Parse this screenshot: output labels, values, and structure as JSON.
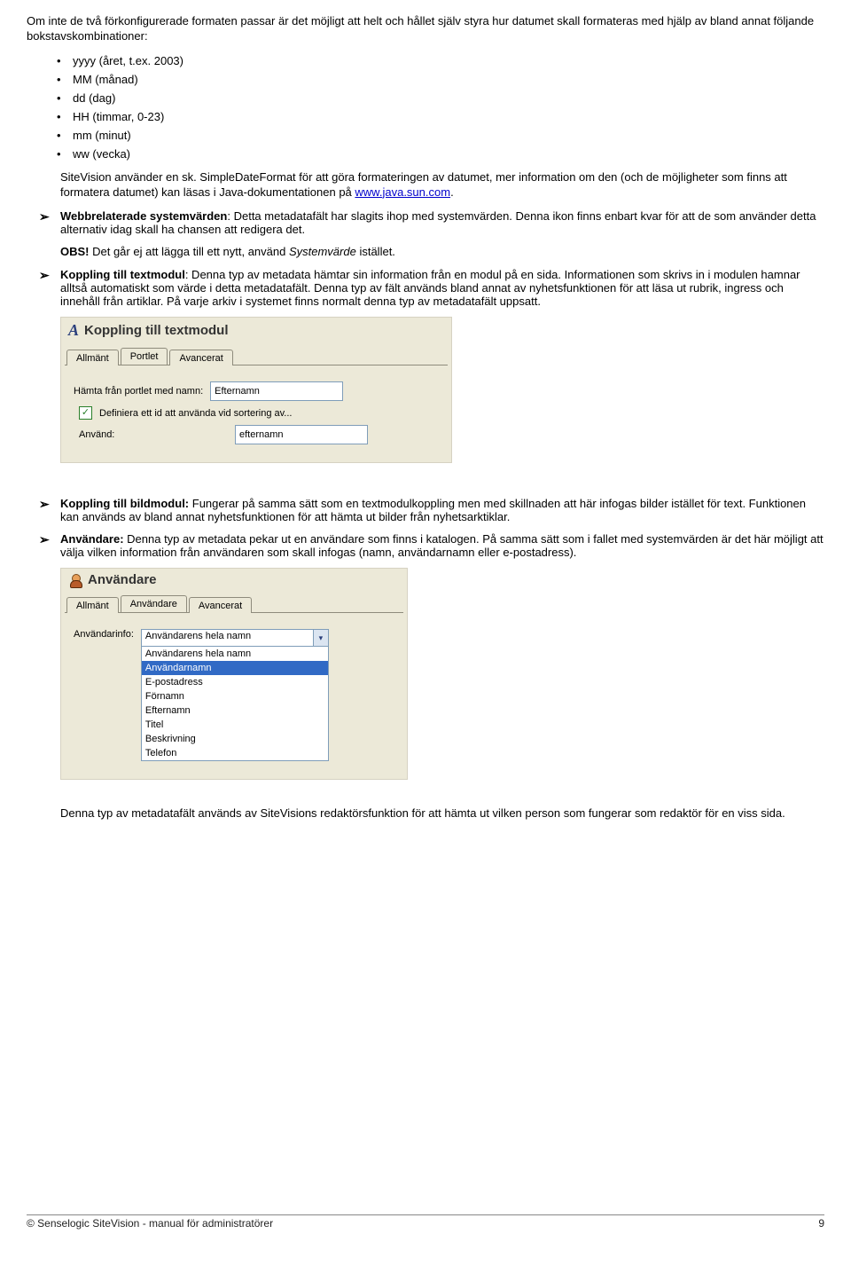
{
  "intro": "Om inte de två förkonfigurerade formaten passar är det möjligt att helt och hållet själv styra hur datumet skall formateras med hjälp av bland annat följande bokstavskombinationer:",
  "format_tokens": [
    "yyyy (året, t.ex. 2003)",
    "MM (månad)",
    "dd (dag)",
    "HH (timmar, 0-23)",
    "mm (minut)",
    "ww (vecka)"
  ],
  "sdf_pre": "SiteVision använder en sk. SimpleDateFormat för att göra formateringen av datumet, mer information om den (och de möjligheter som finns att formatera datumet) kan läsas i Java-dokumentationen på ",
  "sdf_link": "www.java.sun.com",
  "sdf_post": ".",
  "webrel": {
    "label": "Webbrelaterade systemvärden",
    "text": ": Detta metadatafält har slagits ihop med systemvärden. Denna ikon finns enbart kvar för att de som använder detta alternativ idag skall ha chansen att redigera det.",
    "obs_label": "OBS!",
    "obs_text": " Det går ej att lägga till ett nytt, använd ",
    "obs_ital": "Systemvärde",
    "obs_tail": " istället."
  },
  "textmodul": {
    "label": "Koppling till textmodul",
    "text": ": Denna typ av metadata hämtar sin information från en modul på en sida. Informationen som skrivs in i modulen hamnar alltså automatiskt som värde i detta metadatafält. Denna typ av fält används bland annat av nyhetsfunktionen för att läsa ut rubrik, ingress och innehåll från artiklar. På varje arkiv i systemet finns normalt denna typ av metadatafält uppsatt."
  },
  "panel1": {
    "title": "Koppling till textmodul",
    "tabs": [
      "Allmänt",
      "Portlet",
      "Avancerat"
    ],
    "active_tab": 1,
    "row1_label": "Hämta från portlet med namn:",
    "row1_value": "Efternamn",
    "check_label": "Definiera ett id att använda vid sortering av...",
    "row2_label": "Använd:",
    "row2_value": "efternamn"
  },
  "bildmodul": {
    "label": "Koppling till bildmodul:",
    "text": " Fungerar på samma sätt som en textmodulkoppling men med skillnaden att här infogas bilder istället för text. Funktionen kan används av bland annat nyhetsfunktionen för att hämta ut bilder från nyhetsarktiklar."
  },
  "anvandare": {
    "label": "Användare:",
    "text": " Denna typ av metadata pekar ut en användare som finns i katalogen. På samma sätt som i fallet med systemvärden är det här möjligt att välja vilken information från användaren som skall infogas (namn, användarnamn eller e-postadress)."
  },
  "panel2": {
    "title": "Användare",
    "tabs": [
      "Allmänt",
      "Användare",
      "Avancerat"
    ],
    "active_tab": 1,
    "label": "Användarinfo:",
    "selected": "Användarens hela namn",
    "options": [
      "Användarens hela namn",
      "Användarnamn",
      "E-postadress",
      "Förnamn",
      "Efternamn",
      "Titel",
      "Beskrivning",
      "Telefon"
    ],
    "highlight_index": 1
  },
  "closing": "Denna typ av metadatafält används av SiteVisions redaktörsfunktion för att hämta ut vilken person som fungerar som redaktör för en viss sida.",
  "footer_left": "© Senselogic SiteVision - manual för administratörer",
  "footer_right": "9"
}
